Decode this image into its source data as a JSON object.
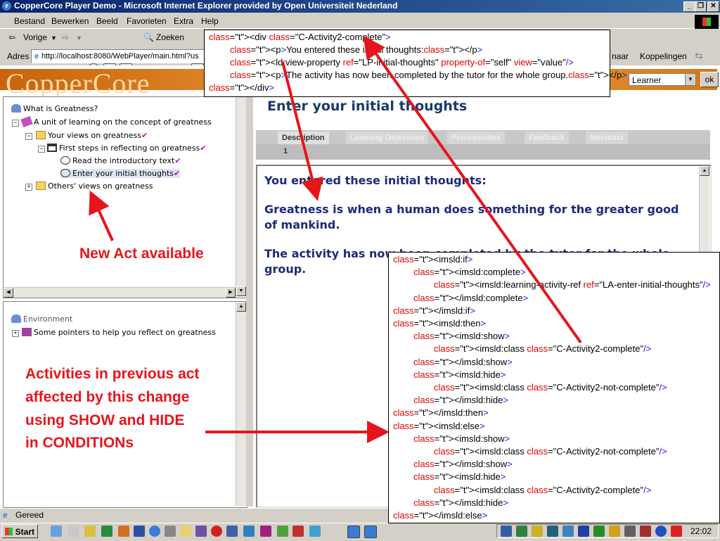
{
  "window": {
    "title": "CopperCore Player Demo - Microsoft Internet Explorer provided by Open Universiteit Nederland",
    "buttons": [
      "_",
      "❐",
      "✕"
    ]
  },
  "menu": [
    "Bestand",
    "Bewerken",
    "Beeld",
    "Favorieten",
    "Extra",
    "Help"
  ],
  "toolbar": {
    "back_label": "Vorige",
    "search_label": "Zoeken"
  },
  "address": {
    "label": "Adres",
    "url": "http://localhost:8080/WebPlayer/main.html?us",
    "go_label": "naar",
    "links_label": "Koppelingen"
  },
  "app": {
    "logo": "CopperCore",
    "role": "Learner",
    "ok_label": "ok"
  },
  "tree": {
    "root": "What is Greatness?",
    "unit": "A unit of learning on the concept of greatness",
    "act1": "Your views on greatness",
    "activity_structure": "First steps in reflecting on greatness",
    "item1": "Read the introductory text",
    "item2": "Enter your initial thoughts",
    "act2": "Others' views on greatness"
  },
  "environment": {
    "title": "Environment",
    "item": "Some pointers to help you reflect on greatness"
  },
  "content": {
    "title": "Enter your initial thoughts",
    "tabs": [
      "Description",
      "Learning Objectives",
      "Prerequisites",
      "Feedback",
      "Metadata"
    ],
    "page_number": "1",
    "line1": "You entered these initial thoughts:",
    "line2": "Greatness is when a human does something for the greater good of mankind.",
    "line3": "The activity has now been completed by the tutor for the whole group."
  },
  "status": {
    "text": "Gereed"
  },
  "taskbar": {
    "start_label": "Start",
    "clock": "22:02"
  },
  "annotations": {
    "new_act": "New Act available",
    "activities_1": "Activities in previous act",
    "activities_2": "affected by this change",
    "activities_3": "using SHOW and HIDE",
    "activities_4": "in CONDITIONs",
    "color": "#e6151b"
  },
  "code_top": [
    "<div class=\"C-Activity2-complete\">",
    "<p>You entered these initial thoughts:</p>",
    "<ld:view-property ref=\"LP-initial-thoughts\" property-of=\"self\" view=\"value\"/>",
    "<p>The activity has now been completed by the tutor for the whole group.</p>",
    "</div>"
  ],
  "code_bottom": [
    "<imsld:if>",
    "<imsld:complete>",
    "<imsld:learning-activity-ref ref=\"LA-enter-initial-thoughts\"/>",
    "</imsld:complete>",
    "</imsld:if>",
    "<imsld:then>",
    "<imsld:show>",
    "<imsld:class class=\"C-Activity2-complete\"/>",
    "</imsld:show>",
    "<imsld:hide>",
    "<imsld:class class=\"C-Activity2-not-complete\"/>",
    "</imsld:hide>",
    "</imsld:then>",
    "<imsld:else>",
    "<imsld:show>",
    "<imsld:class class=\"C-Activity2-not-complete\"/>",
    "</imsld:show>",
    "<imsld:hide>",
    "<imsld:class class=\"C-Activity2-complete\"/>",
    "</imsld:hide>",
    "</imsld:else>"
  ]
}
